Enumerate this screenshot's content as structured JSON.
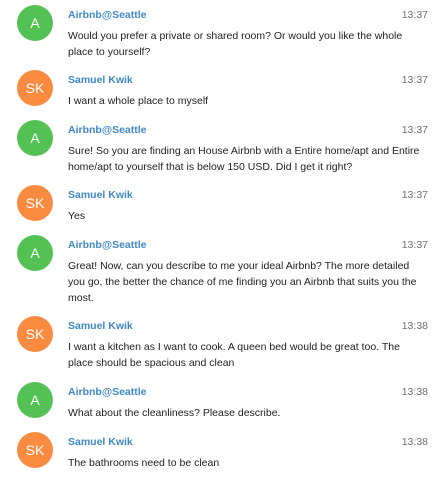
{
  "messages": [
    {
      "initials": "A",
      "avatar_color": "#53c154",
      "sender": "Airbnb@Seattle",
      "time": "13:37",
      "text": "Would you prefer a private or shared room? Or would you like the whole place to yourself?"
    },
    {
      "initials": "SK",
      "avatar_color": "#f98b40",
      "sender": "Samuel Kwik",
      "time": "13:37",
      "text": "I want a whole place to myself"
    },
    {
      "initials": "A",
      "avatar_color": "#53c154",
      "sender": "Airbnb@Seattle",
      "time": "13:37",
      "text": "Sure! So you are finding an House Airbnb with a Entire home/apt and Entire home/apt to yourself that is below 150 USD. Did I get it right?"
    },
    {
      "initials": "SK",
      "avatar_color": "#f98b40",
      "sender": "Samuel Kwik",
      "time": "13:37",
      "text": "Yes"
    },
    {
      "initials": "A",
      "avatar_color": "#53c154",
      "sender": "Airbnb@Seattle",
      "time": "13:37",
      "text": "Great! Now, can you describe to me your ideal Airbnb? The more detailed you go, the better the chance of me finding you an Airbnb that suits you the most."
    },
    {
      "initials": "SK",
      "avatar_color": "#f98b40",
      "sender": "Samuel Kwik",
      "time": "13:38",
      "text": "I want a kitchen as I want to cook. A queen bed would be great too. The place should be spacious and clean"
    },
    {
      "initials": "A",
      "avatar_color": "#53c154",
      "sender": "Airbnb@Seattle",
      "time": "13:38",
      "text": "What about the cleanliness? Please describe."
    },
    {
      "initials": "SK",
      "avatar_color": "#f98b40",
      "sender": "Samuel Kwik",
      "time": "13:38",
      "text": "The bathrooms need to be clean"
    }
  ]
}
